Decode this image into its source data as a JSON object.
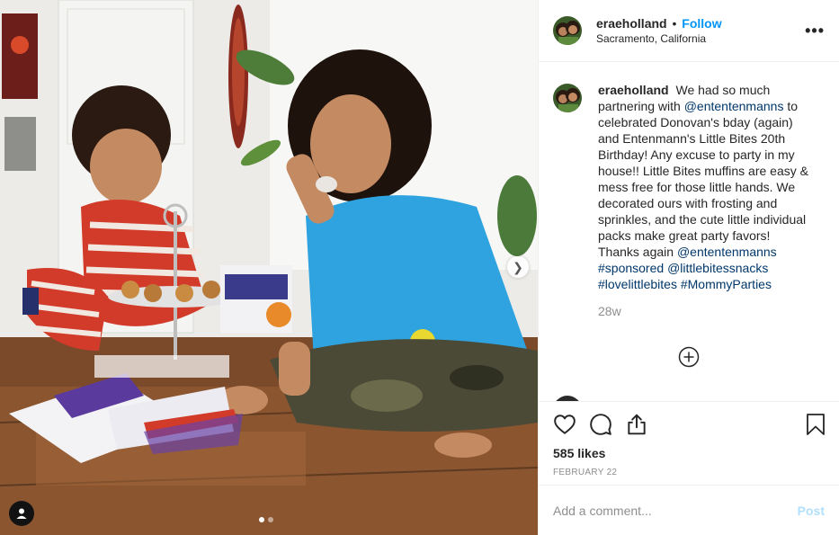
{
  "post": {
    "author": {
      "username": "eraeholland",
      "location": "Sacramento, California",
      "follow_label": "Follow",
      "separator": "•"
    },
    "more_label": "•••",
    "caption": {
      "username": "eraeholland",
      "segments": [
        {
          "text": "We had so much partnering with ",
          "mention": false
        },
        {
          "text": "@ententenmanns",
          "mention": true
        },
        {
          "text": " to celebrated Donovan's bday (again) and Entenmann's Little Bites 20th Birthday! Any excuse to party in my house!! Little Bites muffins are easy & mess free for those little hands. We decorated ours with frosting and sprinkles, and the cute little individual packs make great party favors! Thanks again ",
          "mention": false
        },
        {
          "text": "@ententenmanns",
          "mention": true
        },
        {
          "text": " ",
          "mention": false
        },
        {
          "text": "#sponsored",
          "mention": true
        },
        {
          "text": " ",
          "mention": false
        },
        {
          "text": "@littlebitessnacks",
          "mention": true
        },
        {
          "text": " ",
          "mention": false
        },
        {
          "text": "#lovelittlebites",
          "mention": true
        },
        {
          "text": " ",
          "mention": false
        },
        {
          "text": "#MommyParties",
          "mention": true
        }
      ],
      "age": "28w"
    },
    "likes": "585 likes",
    "date": "FEBRUARY 22",
    "comment": {
      "placeholder": "Add a comment...",
      "post_label": "Post"
    },
    "media": {
      "carousel_count": 2,
      "active_index": 0,
      "next_arrow": "chevron-right-icon",
      "user_tag_icon": "user-icon"
    },
    "colors": {
      "follow": "#0095f6",
      "mention": "#00376b",
      "muted": "#8e8e8e",
      "post_disabled": "#b2dffc"
    }
  }
}
